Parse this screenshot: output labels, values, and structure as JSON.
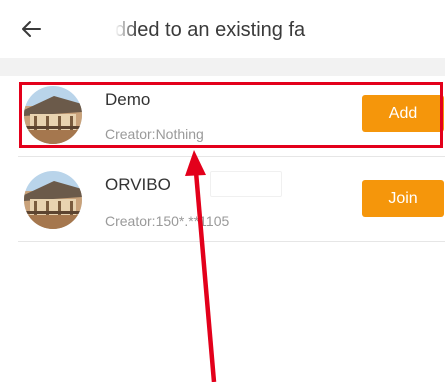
{
  "header": {
    "title": "dded to an existing fa",
    "back_icon": "arrow-left-icon"
  },
  "families": [
    {
      "name": "Demo",
      "creator": "Creator:Nothing",
      "action_label": "Add",
      "avatar_icon": "house-photo-avatar"
    },
    {
      "name": "ORVIBO",
      "creator": "Creator:150*.**1105",
      "action_label": "Join",
      "avatar_icon": "house-photo-avatar"
    }
  ],
  "colors": {
    "accent": "#f5960b",
    "highlight": "#e3001b",
    "divider": "#e6e6e6"
  }
}
